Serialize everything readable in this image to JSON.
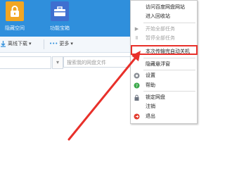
{
  "header": {
    "apps": [
      {
        "label": "隐藏空间",
        "icon": "lock-icon",
        "color": "#f2a623"
      },
      {
        "label": "功能宝箱",
        "icon": "toolbox-icon",
        "color": "#3f6fd0"
      }
    ]
  },
  "toolbar": {
    "download_label": "离线下载",
    "more_label": "更多"
  },
  "search": {
    "placeholder": "搜索我的网盘文件"
  },
  "menu": {
    "items": [
      {
        "label": "访问百度网盘网站",
        "icon": "",
        "disabled": false
      },
      {
        "label": "进入回收站",
        "icon": "",
        "disabled": false
      },
      {
        "label": "开始全部任务",
        "icon": "play-icon",
        "disabled": true
      },
      {
        "label": "暂停全部任务",
        "icon": "pause-icon",
        "disabled": true
      },
      {
        "label": "本次传输完自动关机",
        "icon": "",
        "disabled": false
      },
      {
        "label": "隐藏悬浮窗",
        "icon": "",
        "disabled": false
      },
      {
        "label": "设置",
        "icon": "gear-icon",
        "disabled": false
      },
      {
        "label": "帮助",
        "icon": "help-icon",
        "disabled": false
      },
      {
        "label": "锁定网盘",
        "icon": "lock-icon",
        "disabled": false
      },
      {
        "label": "注销",
        "icon": "",
        "disabled": false
      },
      {
        "label": "退出",
        "icon": "exit-icon",
        "disabled": false
      }
    ],
    "highlight_color": "#e8302a"
  }
}
